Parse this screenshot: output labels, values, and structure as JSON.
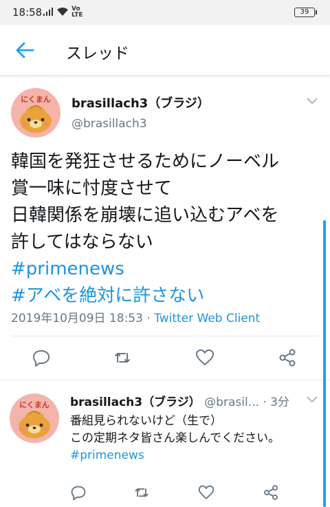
{
  "statusbar": {
    "time": "18:58",
    "volte_top": "Vo",
    "volte_bottom": "LTE",
    "battery": "39"
  },
  "appbar": {
    "back_icon": "arrow-left-icon",
    "title": "スレッド"
  },
  "main_tweet": {
    "avatar_text": "にくまん",
    "display_name": "brasillach3（ブラジ）",
    "handle": "@brasillach3",
    "body_lines": [
      "韓国を発狂させるためにノーベル",
      "賞一味に忖度させて",
      "日韓関係を崩壊に追い込むアベを",
      "許してはならない"
    ],
    "hashtags": [
      "#primenews",
      "#アベを絶対に許さない"
    ],
    "timestamp": "2019年10月09日 18:53",
    "separator": "·",
    "client": "Twitter Web Client",
    "actions": [
      "reply-icon",
      "retweet-icon",
      "like-icon",
      "share-icon"
    ]
  },
  "reply_tweet": {
    "avatar_text": "にくまん",
    "display_name": "brasillach3（ブラジ）",
    "handle": "@brasil...",
    "time": "· 3分",
    "body_lines": [
      "番組見られないけど（生で）",
      "この定期ネタ皆さん楽しんでください。"
    ],
    "hashtag": "#primenews"
  },
  "colors": {
    "accent": "#1b95e0",
    "secondary_text": "#657786",
    "divider": "#e1e8ed",
    "avatar_bg": "#f4b4aa"
  }
}
